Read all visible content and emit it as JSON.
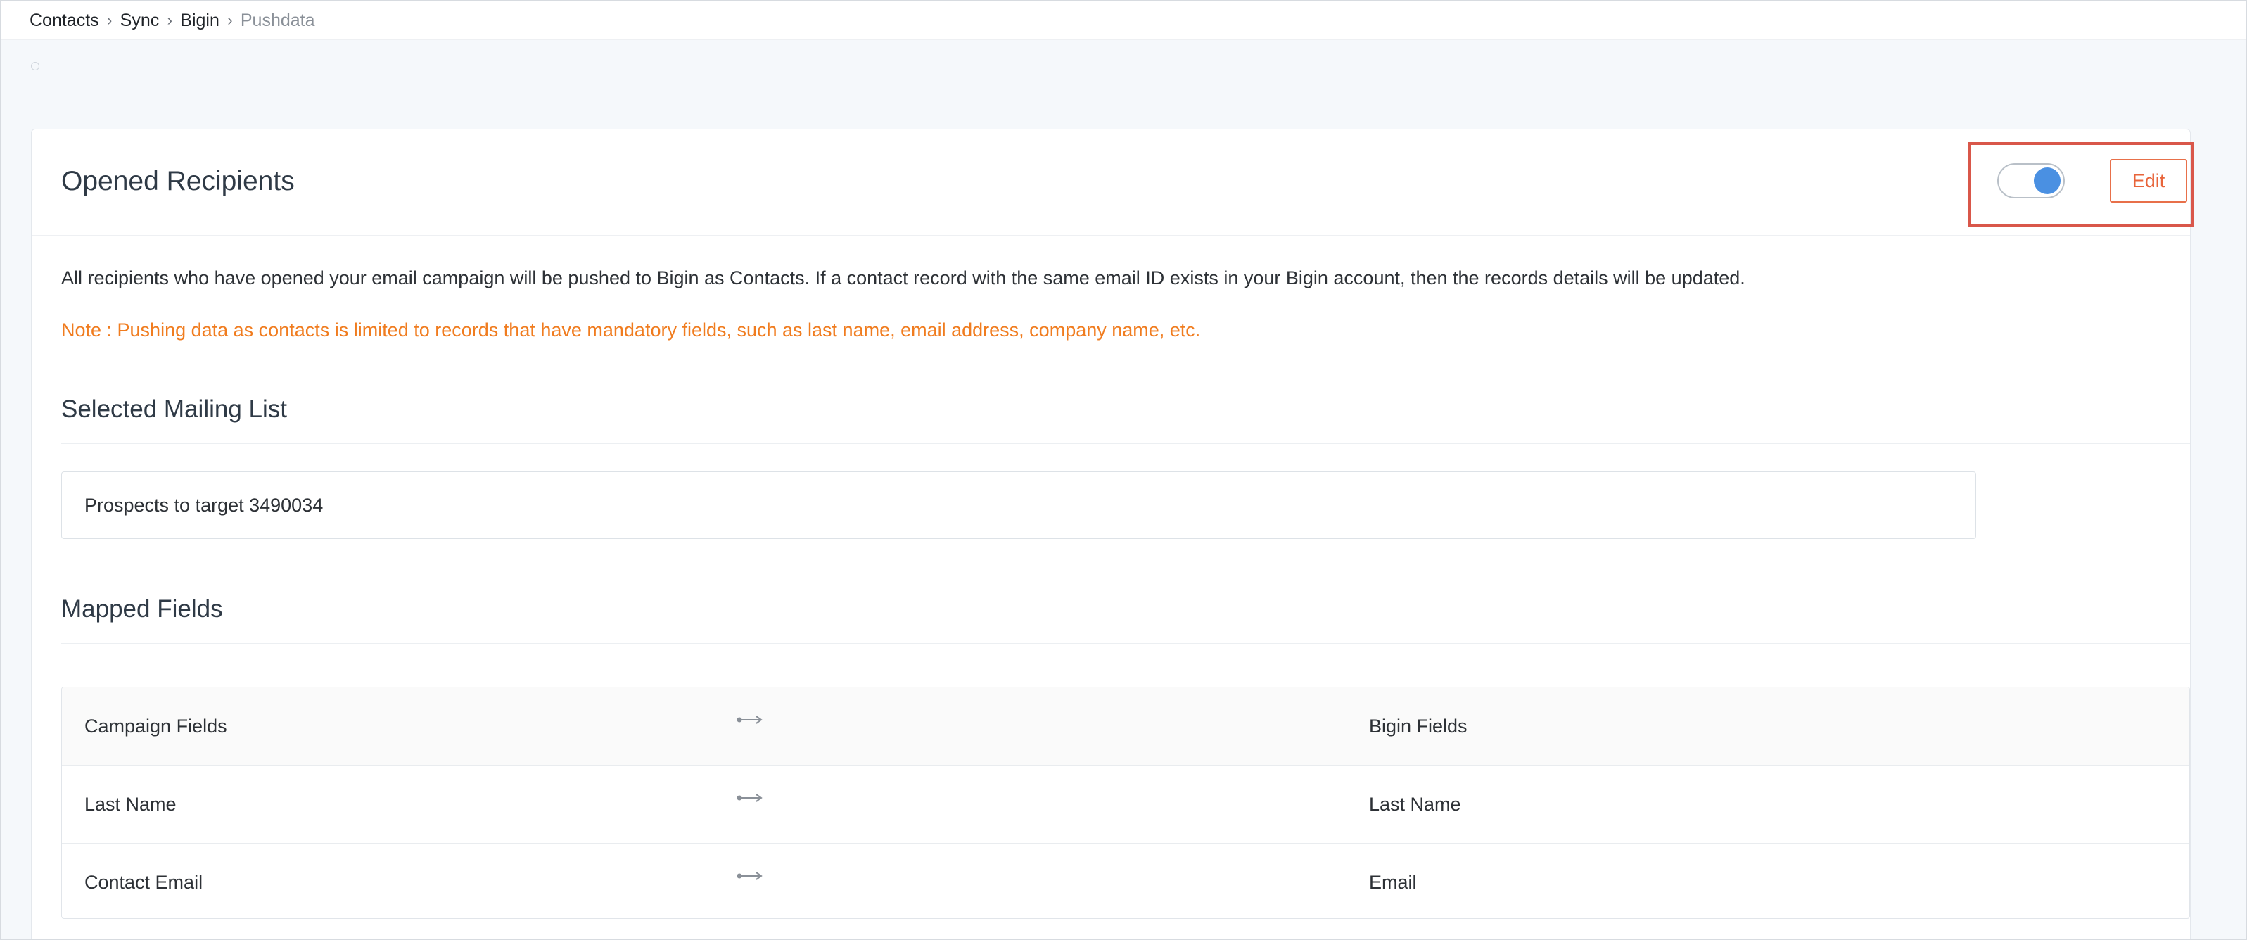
{
  "breadcrumb": {
    "items": [
      "Contacts",
      "Sync",
      "Bigin"
    ],
    "current": "Pushdata",
    "separator": "›"
  },
  "card": {
    "title": "Opened Recipients",
    "toggle": {
      "state": "on",
      "accent": "#4a90e2"
    },
    "edit_label": "Edit",
    "description": "All recipients who have opened your email campaign will be pushed to Bigin as Contacts. If a contact record with the same email ID exists in your Bigin account, then the records details will be updated.",
    "note": "Note : Pushing data as contacts is limited to records that have mandatory fields, such as last name, email address, company name, etc."
  },
  "mailing_list": {
    "heading": "Selected Mailing List",
    "value": "Prospects to target 3490034"
  },
  "mapped_fields": {
    "heading": "Mapped Fields",
    "columns": [
      "Campaign Fields",
      "Bigin Fields"
    ],
    "rows": [
      {
        "campaign": "Last Name",
        "bigin": "Last Name"
      },
      {
        "campaign": "Contact Email",
        "bigin": "Email"
      }
    ]
  },
  "colors": {
    "accent_orange": "#e8643a",
    "note_orange": "#f07c1f",
    "highlight_red": "#d9574a",
    "toggle_blue": "#4a90e2"
  }
}
